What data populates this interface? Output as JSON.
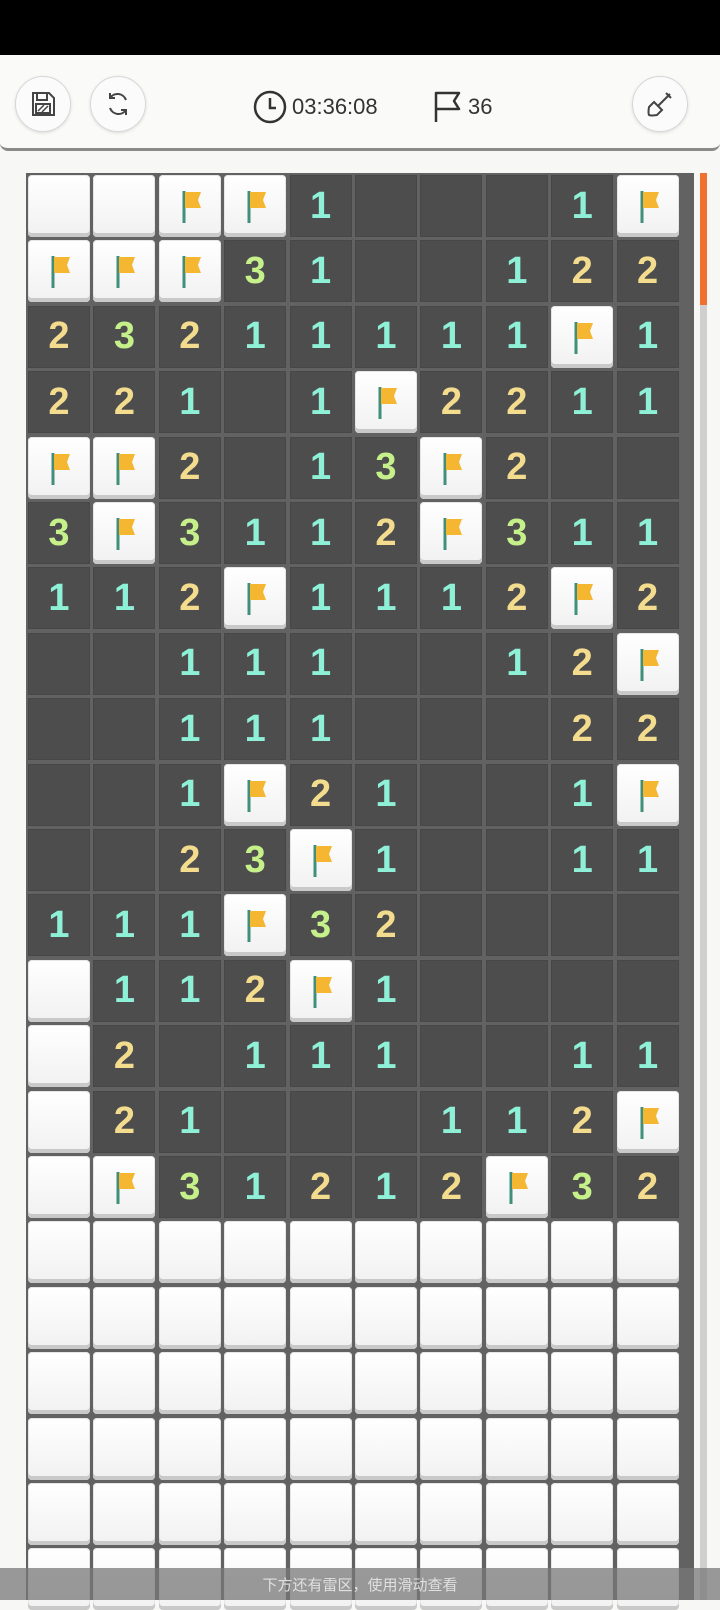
{
  "header": {
    "save_icon": "save-icon",
    "restart_icon": "refresh-icon",
    "timer_icon": "clock-icon",
    "timer": "03:36:08",
    "flag_icon": "flag-icon",
    "flags_count": "36",
    "tool_icon": "shovel-icon"
  },
  "colors": {
    "open_cell": "#4d4d4d",
    "covered_cell": "#ffffff",
    "grid": "#626262",
    "number_1": "#8ff0d8",
    "number_2": "#f3dc8e",
    "number_3": "#c6f08a",
    "flag": "#f5b731",
    "scroll_accent": "#f07030"
  },
  "board": {
    "cols": 10,
    "legend": "C = covered, F = flagged, 0 = open empty, digits = neighbour mine count",
    "rows": [
      [
        "C",
        "C",
        "F",
        "F",
        "1",
        "0",
        "0",
        "0",
        "1",
        "F"
      ],
      [
        "F",
        "F",
        "F",
        "3",
        "1",
        "0",
        "0",
        "1",
        "2",
        "2"
      ],
      [
        "2",
        "3",
        "2",
        "1",
        "1",
        "1",
        "1",
        "1",
        "F",
        "1"
      ],
      [
        "2",
        "2",
        "1",
        "0",
        "1",
        "F",
        "2",
        "2",
        "1",
        "1"
      ],
      [
        "F",
        "F",
        "2",
        "0",
        "1",
        "3",
        "F",
        "2",
        "0",
        "0"
      ],
      [
        "3",
        "F",
        "3",
        "1",
        "1",
        "2",
        "F",
        "3",
        "1",
        "1"
      ],
      [
        "1",
        "1",
        "2",
        "F",
        "1",
        "1",
        "1",
        "2",
        "F",
        "2"
      ],
      [
        "0",
        "0",
        "1",
        "1",
        "1",
        "0",
        "0",
        "1",
        "2",
        "F"
      ],
      [
        "0",
        "0",
        "1",
        "1",
        "1",
        "0",
        "0",
        "0",
        "2",
        "2"
      ],
      [
        "0",
        "0",
        "1",
        "F",
        "2",
        "1",
        "0",
        "0",
        "1",
        "F"
      ],
      [
        "0",
        "0",
        "2",
        "3",
        "F",
        "1",
        "0",
        "0",
        "1",
        "1"
      ],
      [
        "1",
        "1",
        "1",
        "F",
        "3",
        "2",
        "0",
        "0",
        "0",
        "0"
      ],
      [
        "C",
        "1",
        "1",
        "2",
        "F",
        "1",
        "0",
        "0",
        "0",
        "0"
      ],
      [
        "C",
        "2",
        "0",
        "1",
        "1",
        "1",
        "0",
        "0",
        "1",
        "1"
      ],
      [
        "C",
        "2",
        "1",
        "0",
        "0",
        "0",
        "1",
        "1",
        "2",
        "F"
      ],
      [
        "C",
        "F",
        "3",
        "1",
        "2",
        "1",
        "2",
        "F",
        "3",
        "2"
      ],
      [
        "C",
        "C",
        "C",
        "C",
        "C",
        "C",
        "C",
        "C",
        "C",
        "C"
      ],
      [
        "C",
        "C",
        "C",
        "C",
        "C",
        "C",
        "C",
        "C",
        "C",
        "C"
      ],
      [
        "C",
        "C",
        "C",
        "C",
        "C",
        "C",
        "C",
        "C",
        "C",
        "C"
      ],
      [
        "C",
        "C",
        "C",
        "C",
        "C",
        "C",
        "C",
        "C",
        "C",
        "C"
      ],
      [
        "C",
        "C",
        "C",
        "C",
        "C",
        "C",
        "C",
        "C",
        "C",
        "C"
      ],
      [
        "C",
        "C",
        "C",
        "C",
        "C",
        "C",
        "C",
        "C",
        "C",
        "C"
      ]
    ]
  },
  "hint": "下方还有雷区，使用滑动查看"
}
